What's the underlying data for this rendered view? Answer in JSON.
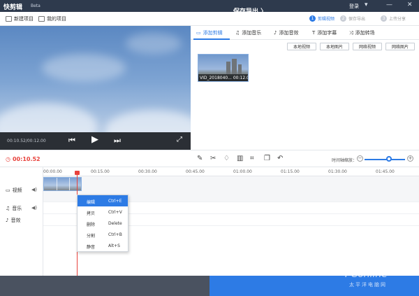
{
  "app": {
    "title": "快剪辑",
    "badge": "Beta",
    "login": "登录"
  },
  "toolbar": {
    "new_project": "新建项目",
    "my_projects": "我的项目"
  },
  "steps": [
    {
      "num": "1",
      "label": "剪辑视频",
      "active": true
    },
    {
      "num": "2",
      "label": "保存导出",
      "active": false
    },
    {
      "num": "3",
      "label": "上传分享",
      "active": false
    }
  ],
  "player": {
    "time": "00:10.52/00:12.00"
  },
  "tabs": [
    {
      "label": "添加剪辑",
      "active": true
    },
    {
      "label": "添加音乐",
      "active": false
    },
    {
      "label": "添加音效",
      "active": false
    },
    {
      "label": "添加字幕",
      "active": false
    },
    {
      "label": "添加转场",
      "active": false
    }
  ],
  "sources": [
    "本地视频",
    "本地图片",
    "网络视频",
    "网络图片"
  ],
  "media": {
    "thumb_caption": "VID_2018040... 00:12.04"
  },
  "edit": {
    "current_time": "00:10.52",
    "zoom_label": "时间轴缩放："
  },
  "ruler": [
    "00:00.00",
    "00:15.00",
    "00:30.00",
    "00:45.00",
    "01:00.00",
    "01:15.00",
    "01:30.00",
    "01:45.00"
  ],
  "tracks": [
    {
      "label": "视频"
    },
    {
      "label": "音乐"
    },
    {
      "label": "音效"
    }
  ],
  "context_menu": [
    {
      "label": "编辑",
      "shortcut": "Ctrl+E",
      "highlight": true
    },
    {
      "label": "拷贝",
      "shortcut": "Ctrl+V",
      "highlight": false
    },
    {
      "label": "删除",
      "shortcut": "Delete",
      "highlight": false
    },
    {
      "label": "分割",
      "shortcut": "Ctrl+B",
      "highlight": false
    },
    {
      "label": "静音",
      "shortcut": "Alt+S",
      "highlight": false
    }
  ],
  "footer": {
    "export": "保存导出 〉"
  },
  "watermark": {
    "brand": "PConline",
    "sub": "太平洋电脑网"
  },
  "colors": {
    "accent": "#2d7be5",
    "playhead": "#e8423c",
    "titlebar": "#2e3a4d"
  },
  "icons": [
    "pencil-icon",
    "scissors-icon",
    "bell-icon",
    "trash-icon",
    "crop-icon",
    "copy-icon",
    "undo-icon"
  ]
}
